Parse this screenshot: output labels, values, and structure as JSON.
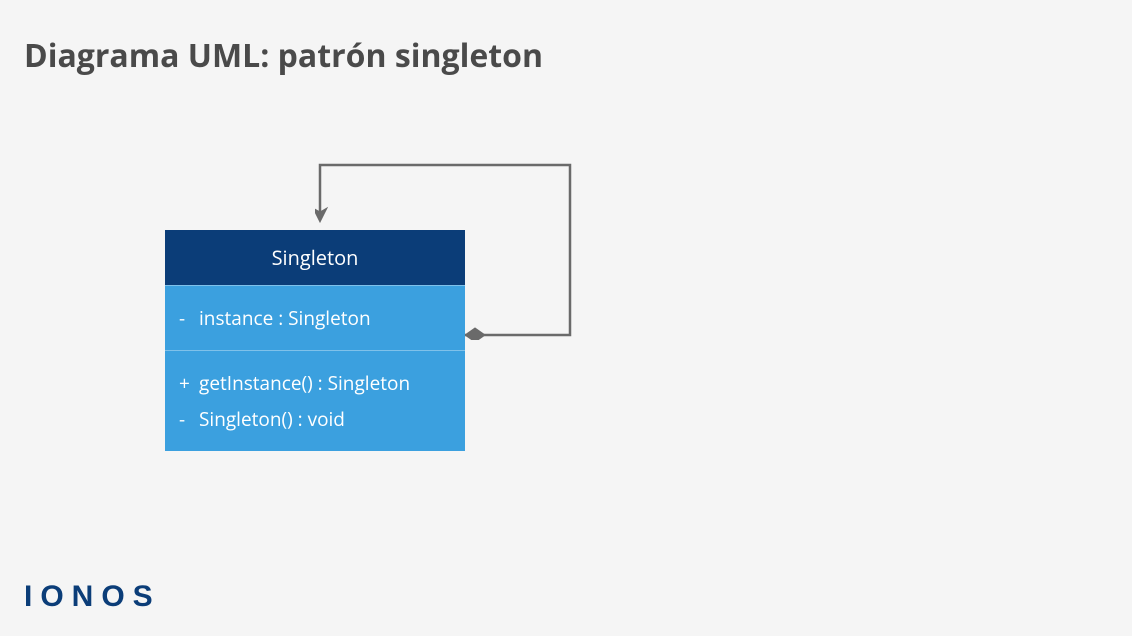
{
  "title": "Diagrama UML: patrón singleton",
  "class": {
    "name": "Singleton",
    "attributes": [
      {
        "visibility": "-",
        "text": "instance : Singleton"
      }
    ],
    "operations": [
      {
        "visibility": "+",
        "text": "getInstance() : Singleton"
      },
      {
        "visibility": "-",
        "text": "Singleton() : void"
      }
    ]
  },
  "branding": "IONOS"
}
